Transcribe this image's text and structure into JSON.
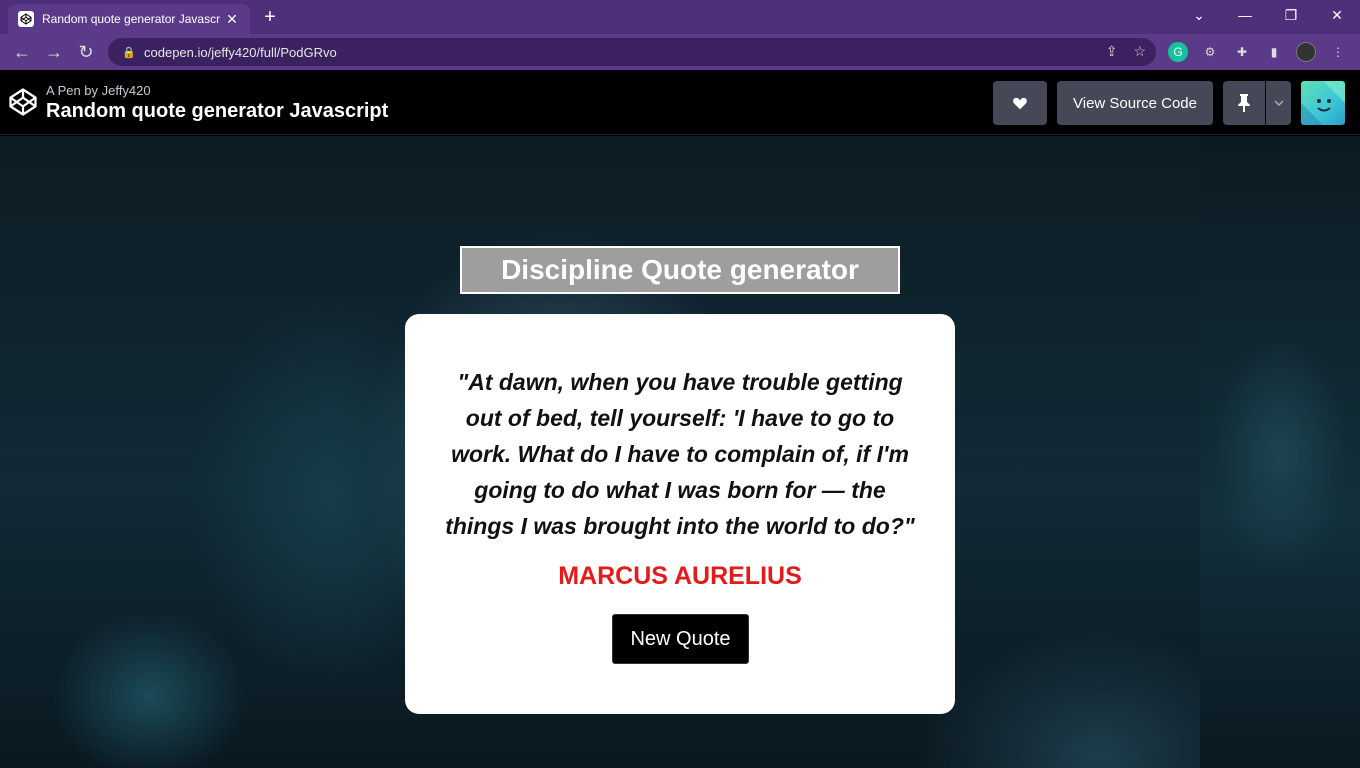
{
  "browser": {
    "tab_title": "Random quote generator Javascr",
    "tab_close": "✕",
    "new_tab": "+",
    "url": "codepen.io/jeffy420/full/PodGRvo",
    "controls": {
      "minimize": "—",
      "restore": "❐",
      "close": "✕",
      "tab_search": "⌄"
    }
  },
  "codepen": {
    "byline": "A Pen by Jeffy420",
    "pen_title": "Random quote generator Javascript",
    "like_icon": "heart-icon",
    "view_source_label": "View Source Code",
    "pin_icon": "pin-icon",
    "dropdown_icon": "chevron-down-icon"
  },
  "app": {
    "heading": "Discipline Quote generator",
    "quote": "\"At dawn, when you have trouble getting out of bed, tell yourself: 'I have to go to work. What do I have to complain of, if I'm going to do what I was born for — the things I was brought into the world to do?\"",
    "author": "MARCUS AURELIUS",
    "button_label": "New Quote"
  },
  "colors": {
    "browser_frame": "#4e2f7a",
    "author_red": "#e31b1b",
    "codepen_button": "#444857"
  }
}
